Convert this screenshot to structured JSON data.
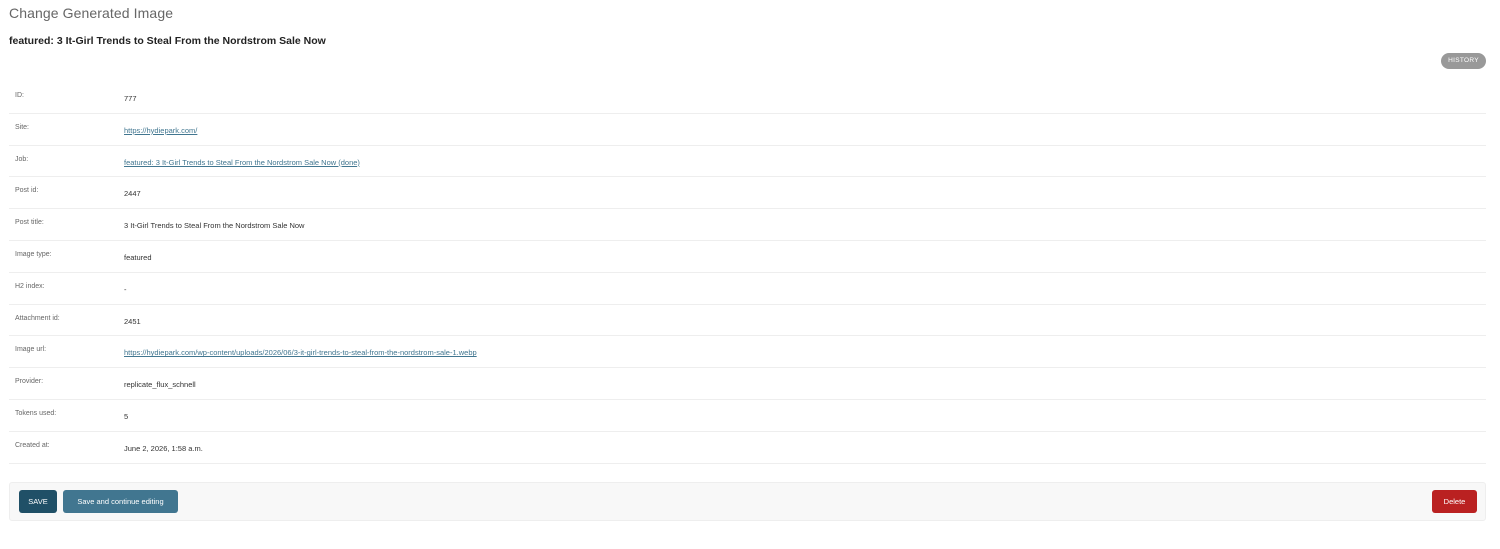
{
  "header": {
    "page_title": "Change Generated Image",
    "object_title": "featured: 3 It-Girl Trends to Steal From the Nordstrom Sale Now",
    "history_label": "HISTORY"
  },
  "fields": [
    {
      "label": "ID:",
      "value": "777",
      "is_link": false
    },
    {
      "label": "Site:",
      "value": "https://hydiepark.com/",
      "is_link": true
    },
    {
      "label": "Job:",
      "value": "featured: 3 It-Girl Trends to Steal From the Nordstrom Sale Now (done)",
      "is_link": true
    },
    {
      "label": "Post id:",
      "value": "2447",
      "is_link": false
    },
    {
      "label": "Post title:",
      "value": "3 It-Girl Trends to Steal From the Nordstrom Sale Now",
      "is_link": false
    },
    {
      "label": "Image type:",
      "value": "featured",
      "is_link": false
    },
    {
      "label": "H2 index:",
      "value": "-",
      "is_link": false
    },
    {
      "label": "Attachment id:",
      "value": "2451",
      "is_link": false
    },
    {
      "label": "Image url:",
      "value": "https://hydiepark.com/wp-content/uploads/2026/06/3-it-girl-trends-to-steal-from-the-nordstrom-sale-1.webp",
      "is_link": true
    },
    {
      "label": "Provider:",
      "value": "replicate_flux_schnell",
      "is_link": false
    },
    {
      "label": "Tokens used:",
      "value": "5",
      "is_link": false
    },
    {
      "label": "Created at:",
      "value": "June 2, 2026, 1:58 a.m.",
      "is_link": false
    }
  ],
  "actions": {
    "save_label": "SAVE",
    "save_continue_label": "Save and continue editing",
    "delete_label": "Delete"
  },
  "colors": {
    "link": "#417690",
    "save": "#205067",
    "save_continue": "#417690",
    "delete": "#ba2121",
    "history": "#999999"
  }
}
